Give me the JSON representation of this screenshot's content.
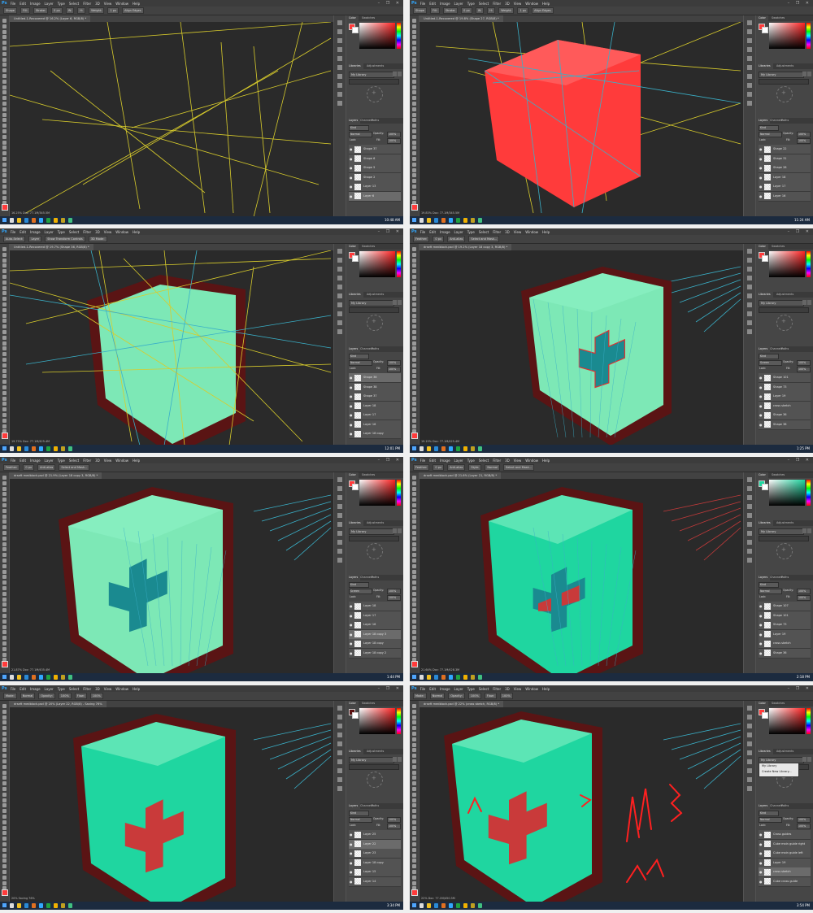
{
  "colors": {
    "canvas_bg": "#2a2a2a",
    "guide_yellow": "#d8cc2c",
    "guide_cyan": "#3ab0c8",
    "red_shape": "#ff3b3b",
    "mint": "#7de8b6",
    "teal_face": "#1fd6a0",
    "dark_red_halo": "#5a1414",
    "photoshop_blue": "#31a8ff",
    "taskbar": "#1c2b3f"
  },
  "common": {
    "app": "Ps",
    "menus": [
      "File",
      "Edit",
      "Image",
      "Layer",
      "Type",
      "Select",
      "Filter",
      "3D",
      "View",
      "Window",
      "Help"
    ],
    "window_controls": "–  ❐  ✕",
    "color_tabs": [
      "Color",
      "Swatches"
    ],
    "lib_tabs": [
      "Libraries",
      "Adjustments"
    ],
    "layer_tabs": [
      "Layers",
      "Channels",
      "Paths"
    ],
    "my_library": "My Library",
    "kind_label": "Kind",
    "lock_label": "Lock:",
    "fill_label": "Fill:",
    "fill_value": "100%",
    "opacity_label": "Opacity:",
    "opacity_value": "100%"
  },
  "panels": [
    {
      "doc_title": "Untitled-1-Recovered @ 16.2% (Layer 6, RGB/8) *",
      "options": [
        "Shape",
        "Fill:",
        "Stroke:",
        "0 px",
        "W:",
        "H:",
        "Weight:",
        "1 px",
        "Align Edges"
      ],
      "blend_mode": "Normal",
      "layers": [
        "Shape 37",
        "Shape 6",
        "Shape 5",
        "Shape 2",
        "Layer 13",
        "Layer 6"
      ],
      "selected_layer": 5,
      "status": "16.25%   Doc: 77.1M/345.5M",
      "time": "10:48 AM"
    },
    {
      "doc_title": "Untitled-1-Recovered @ 19.8% (Shape 27, RGB/8) *",
      "options": [
        "Shape",
        "Fill:",
        "Stroke:",
        "0 px",
        "W:",
        "H:",
        "Weight:",
        "1 px",
        "Align Edges"
      ],
      "blend_mode": "Normal",
      "layers": [
        "Shape 22",
        "Shape 31",
        "Shape 28",
        "Layer 18",
        "Layer 17",
        "Layer 16"
      ],
      "selected_layer": -1,
      "status": "19.83%   Doc: 77.1M/345.5M",
      "time": "11:24 AM"
    },
    {
      "doc_title": "Untitled-1-Recovered @ 19.7% (Shape 36, RGB/8) *",
      "options": [
        "Auto-Select:",
        "Layer",
        "Show Transform Controls",
        "3D Mode:"
      ],
      "blend_mode": "Normal",
      "layers": [
        "Shape 36",
        "Shape 38",
        "Shape 37",
        "Layer 18",
        "Layer 17",
        "Layer 16",
        "Layer 18 copy"
      ],
      "selected_layer": 0,
      "status": "19.75%   Doc: 77.1M/425.4M",
      "time": "12:01 PM"
    },
    {
      "doc_title": "drseft medblock.psd @ 19.2% (Layer 18 copy 3, RGB/8) *",
      "options": [
        "Feather:",
        "0 px",
        "Anti-alias",
        "Select and Mask..."
      ],
      "blend_mode": "Screen",
      "layers": [
        "Shape 101",
        "Shape 73",
        "Layer 19",
        "cross sketch",
        "Shape 36",
        "Shape 38"
      ],
      "selected_layer": -1,
      "status": "19.19%   Doc: 77.1M/425.4M",
      "time": "1:25 PM"
    },
    {
      "doc_title": "drseft medblock.psd @ 21.9% (Layer 18 copy 3, RGB/8) *",
      "options": [
        "Feather:",
        "0 px",
        "Anti-alias",
        "Select and Mask..."
      ],
      "blend_mode": "Screen",
      "layers": [
        "Layer 18",
        "Layer 17",
        "Layer 16",
        "Layer 18 copy 3",
        "Layer 18 copy",
        "Layer 18 copy 2"
      ],
      "selected_layer": 3,
      "status": "21.87%   Doc: 77.1M/435.4M",
      "time": "1:44 PM"
    },
    {
      "doc_title": "drseft medblock.psd @ 21.6% (Layer 21, RGB/8) *",
      "options": [
        "Feather:",
        "0 px",
        "Anti-alias",
        "Style:",
        "Normal",
        "Select and Mask..."
      ],
      "blend_mode": "Normal",
      "layers": [
        "Shape 107",
        "Shape 101",
        "Shape 73",
        "Layer 19",
        "cross sketch",
        "Shape 36"
      ],
      "selected_layer": -1,
      "status": "21.64%   Doc: 77.1M/428.3M",
      "time": "2:18 PM"
    },
    {
      "doc_title": "drseft medblock.psd @ 20% (Layer 22, RGB/8) - Saving 76%",
      "options": [
        "Mode:",
        "Normal",
        "Opacity:",
        "100%",
        "Flow:",
        "100%"
      ],
      "blend_mode": "Normal",
      "layers": [
        "Layer 25",
        "Layer 22",
        "Layer 23",
        "Layer 18 copy",
        "Layer 15",
        "Layer 14"
      ],
      "selected_layer": 1,
      "status": "20%   Saving 76%",
      "time": "3:34 PM"
    },
    {
      "doc_title": "drseft medblock.psd @ 22% (cross sketch, RGB/8) *",
      "options": [
        "Mode:",
        "Normal",
        "Opacity:",
        "100%",
        "Flow:",
        "100%"
      ],
      "blend_mode": "Normal",
      "layers": [
        "Cross guides",
        "Cube main guide right",
        "Cube main guide left",
        "Layer 19",
        "cross sketch",
        "Cube cross guide"
      ],
      "selected_layer": 4,
      "status": "22%   Doc: 77.1M/450.3M",
      "time": "3:54 PM",
      "library_dropdown": [
        "My Library",
        "Create New Library..."
      ]
    }
  ]
}
